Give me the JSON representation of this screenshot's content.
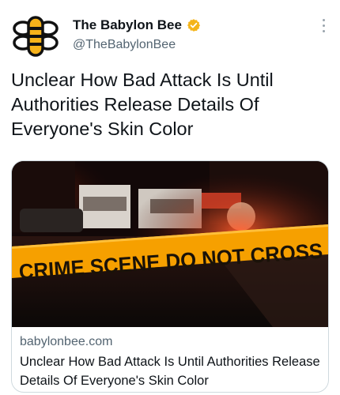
{
  "author": {
    "name": "The Babylon Bee",
    "handle": "@TheBabylonBee",
    "verified": true,
    "verified_color": "#f4b41a"
  },
  "tweet": {
    "text": "Unclear How Bad Attack Is Until Authorities Release Details Of Everyone's Skin Color"
  },
  "card": {
    "domain": "babylonbee.com",
    "title": "Unclear How Bad Attack Is Until Authorities Release Details Of Everyone's Skin Color",
    "tape_text": "CRIME SCENE DO NOT CROSS"
  },
  "icons": {
    "more": "more-options-icon",
    "verified": "verified-badge-icon",
    "logo": "babylon-bee-logo"
  },
  "colors": {
    "text": "#0f1419",
    "secondary": "#536471",
    "tape": "#f6a000"
  }
}
